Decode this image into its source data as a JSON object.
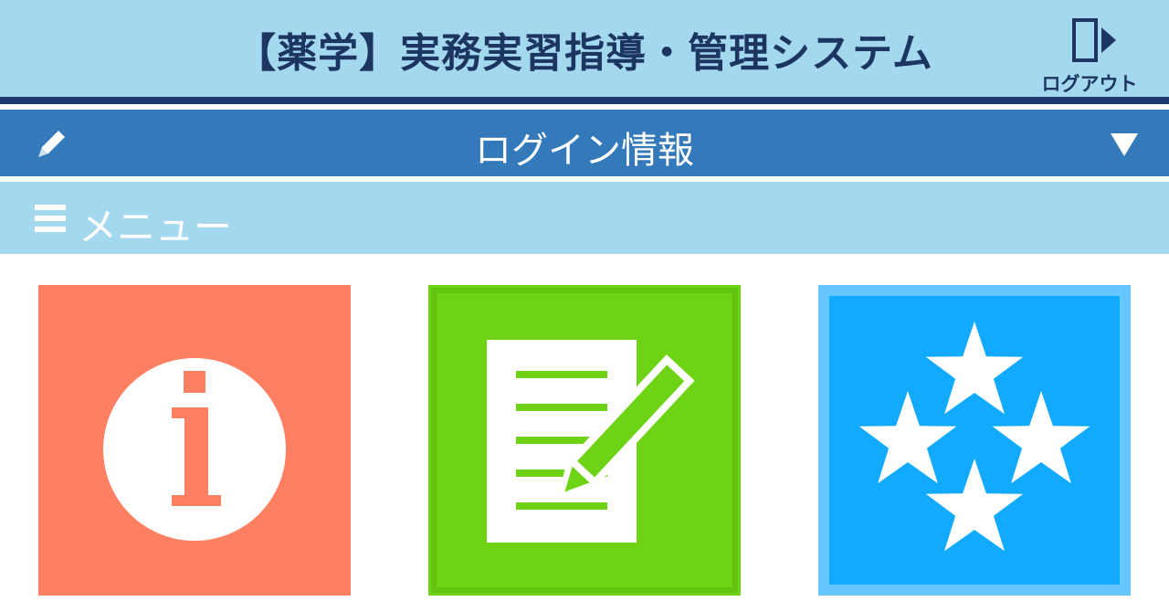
{
  "header": {
    "title": "【薬学】実務実習指導・管理システム",
    "logout_label": "ログアウト"
  },
  "login_bar": {
    "title": "ログイン情報"
  },
  "menu": {
    "title": "メニュー",
    "tiles": [
      {
        "icon": "info-icon",
        "label": "",
        "color": "#ff7f62"
      },
      {
        "icon": "report-icon",
        "label": "",
        "color": "#6fd315"
      },
      {
        "icon": "stars-icon",
        "label": "",
        "color": "#11aaff"
      }
    ]
  },
  "colors": {
    "header_bg": "#a3d8ef",
    "header_text": "#1d3561",
    "login_bar_bg": "#3479b9",
    "menu_label": "#4aa8de"
  }
}
